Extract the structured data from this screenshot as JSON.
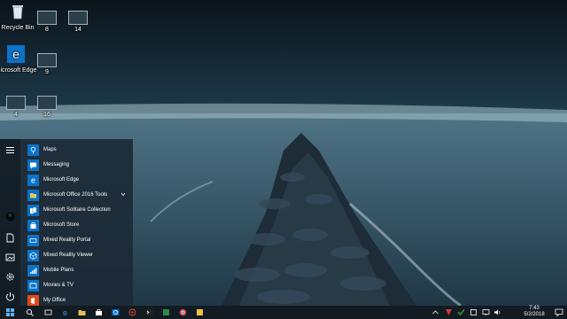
{
  "desktop": {
    "icons": [
      {
        "id": "recycle",
        "label": "Recycle Bin"
      },
      {
        "id": "win8",
        "label": "8"
      },
      {
        "id": "win14",
        "label": "14"
      },
      {
        "id": "edge",
        "label": "Microsoft Edge"
      },
      {
        "id": "win9",
        "label": "9"
      },
      {
        "id": "win4",
        "label": "4"
      },
      {
        "id": "win16",
        "label": "16"
      }
    ]
  },
  "start_menu": {
    "apps": [
      {
        "label": "Maps",
        "icon": "map-icon",
        "color": "#0a72c8"
      },
      {
        "label": "Messaging",
        "icon": "chat-icon",
        "color": "#0a72c8"
      },
      {
        "label": "Microsoft Edge",
        "icon": "edge-icon",
        "color": "#0a72c8"
      },
      {
        "label": "Microsoft Office 2016 Tools",
        "icon": "folder-icon",
        "color": "#d9b84a",
        "expandable": true
      },
      {
        "label": "Microsoft Solitaire Collection",
        "icon": "cards-icon",
        "color": "#0a72c8"
      },
      {
        "label": "Microsoft Store",
        "icon": "store-icon",
        "color": "#0a72c8"
      },
      {
        "label": "Mixed Reality Portal",
        "icon": "vr-icon",
        "color": "#0a72c8"
      },
      {
        "label": "Mixed Reality Viewer",
        "icon": "cube-icon",
        "color": "#0a72c8"
      },
      {
        "label": "Mobile Plans",
        "icon": "signal-icon",
        "color": "#0a72c8"
      },
      {
        "label": "Movies & TV",
        "icon": "film-icon",
        "color": "#0a72c8"
      },
      {
        "label": "My Office",
        "icon": "office-icon",
        "color": "#e04a1b"
      }
    ],
    "rail": [
      "hamburger-icon",
      "avatar",
      "document-icon",
      "pictures-icon",
      "settings-icon",
      "power-icon"
    ]
  },
  "taskbar": {
    "time": "7:43",
    "date": "5/2/2018",
    "accent": "#0a72c8"
  }
}
